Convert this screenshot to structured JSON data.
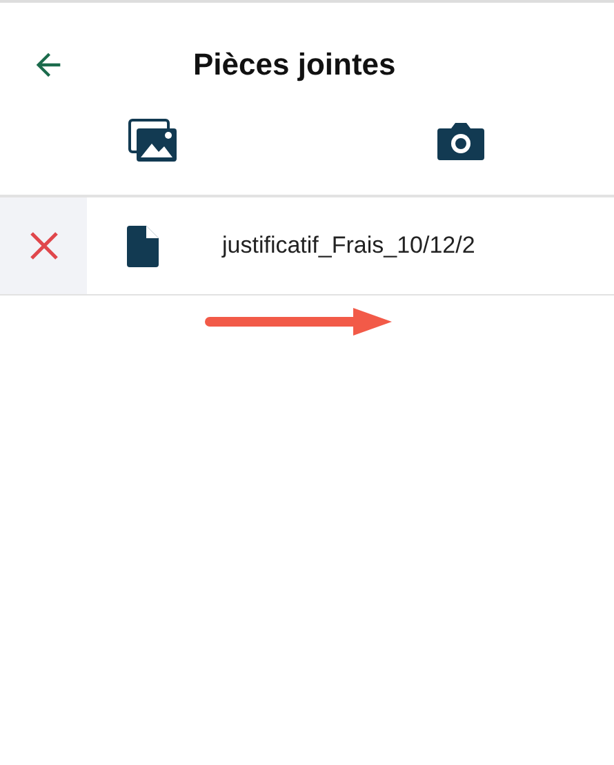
{
  "header": {
    "title": "Pièces jointes"
  },
  "attachments": [
    {
      "file_name": "justificatif_Frais_10/12/2"
    }
  ]
}
